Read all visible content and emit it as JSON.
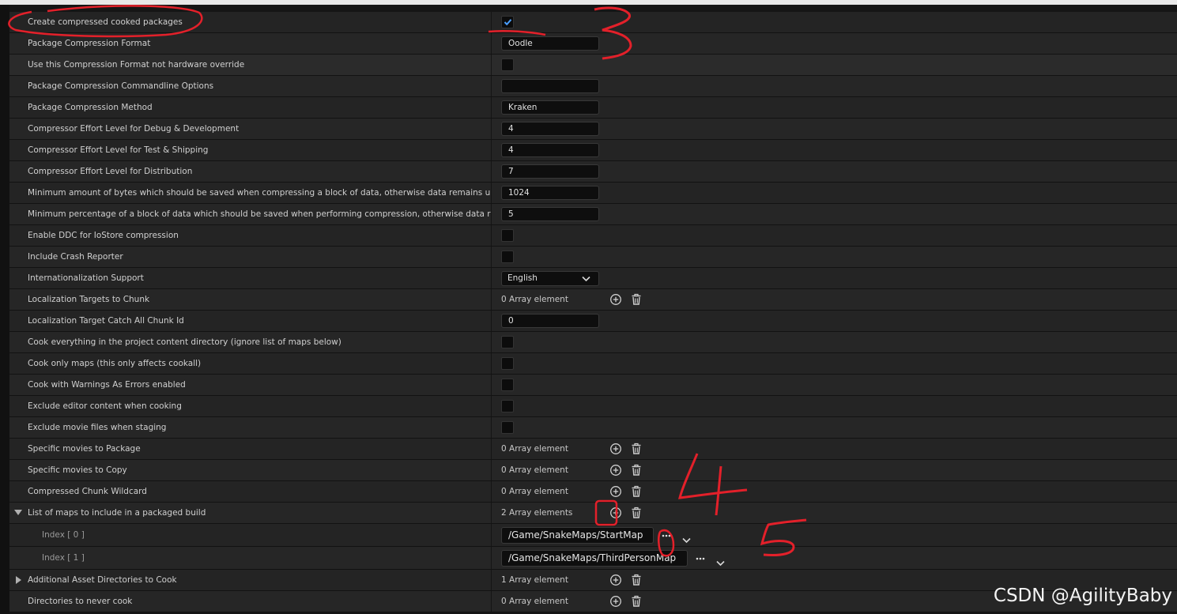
{
  "rows": [
    {
      "label": "Create compressed cooked packages",
      "type": "checkbox",
      "checked": true
    },
    {
      "label": "Package Compression Format",
      "type": "text",
      "value": "Oodle"
    },
    {
      "label": "Use this Compression Format not hardware override",
      "type": "checkbox",
      "checked": false
    },
    {
      "label": "Package Compression Commandline Options",
      "type": "text",
      "value": ""
    },
    {
      "label": "Package Compression Method",
      "type": "text",
      "value": "Kraken"
    },
    {
      "label": "Compressor Effort Level for Debug & Development",
      "type": "text",
      "value": "4"
    },
    {
      "label": "Compressor Effort Level for Test & Shipping",
      "type": "text",
      "value": "4"
    },
    {
      "label": "Compressor Effort Level for Distribution",
      "type": "text",
      "value": "7"
    },
    {
      "label": "Minimum amount of bytes which should be saved when compressing a block of data, otherwise data remains unco...",
      "type": "text",
      "value": "1024"
    },
    {
      "label": "Minimum percentage of a block of data which should be saved when performing compression, otherwise data rema...",
      "type": "text",
      "value": "5"
    },
    {
      "label": "Enable DDC for IoStore compression",
      "type": "checkbox",
      "checked": false
    },
    {
      "label": "Include Crash Reporter",
      "type": "checkbox",
      "checked": false
    },
    {
      "label": "Internationalization Support",
      "type": "dropdown",
      "value": "English"
    },
    {
      "label": "Localization Targets to Chunk",
      "type": "array",
      "value": "0 Array element"
    },
    {
      "label": "Localization Target Catch All Chunk Id",
      "type": "text",
      "value": "0"
    },
    {
      "label": "Cook everything in the project content directory (ignore list of maps below)",
      "type": "checkbox",
      "checked": false
    },
    {
      "label": "Cook only maps (this only affects cookall)",
      "type": "checkbox",
      "checked": false
    },
    {
      "label": "Cook with Warnings As Errors enabled",
      "type": "checkbox",
      "checked": false
    },
    {
      "label": "Exclude editor content when cooking",
      "type": "checkbox",
      "checked": false
    },
    {
      "label": "Exclude movie files when staging",
      "type": "checkbox",
      "checked": false
    },
    {
      "label": "Specific movies to Package",
      "type": "array",
      "value": "0 Array element"
    },
    {
      "label": "Specific movies to Copy",
      "type": "array",
      "value": "0 Array element"
    },
    {
      "label": "Compressed Chunk Wildcard",
      "type": "array",
      "value": "0 Array element"
    },
    {
      "label": "List of maps to include in a packaged build",
      "type": "array",
      "value": "2 Array elements",
      "expanded": true
    },
    {
      "label": "Index [ 0 ]",
      "type": "map",
      "value": "/Game/SnakeMaps/StartMap"
    },
    {
      "label": "Index [ 1 ]",
      "type": "map",
      "value": "/Game/SnakeMaps/ThirdPersonMap"
    },
    {
      "label": "Additional Asset Directories to Cook",
      "type": "array",
      "value": "1 Array element",
      "collapsed": true
    },
    {
      "label": "Directories to never cook",
      "type": "array",
      "value": "0 Array element"
    }
  ],
  "annotations": {
    "n3": "3",
    "n4": "4",
    "n5": "5",
    "color": "#e3202a"
  },
  "watermark": "CSDN @AgilityBaby",
  "colors": {
    "background": "#242424",
    "field": "#0e0e0e",
    "checkbox_check": "#4a9eff"
  }
}
